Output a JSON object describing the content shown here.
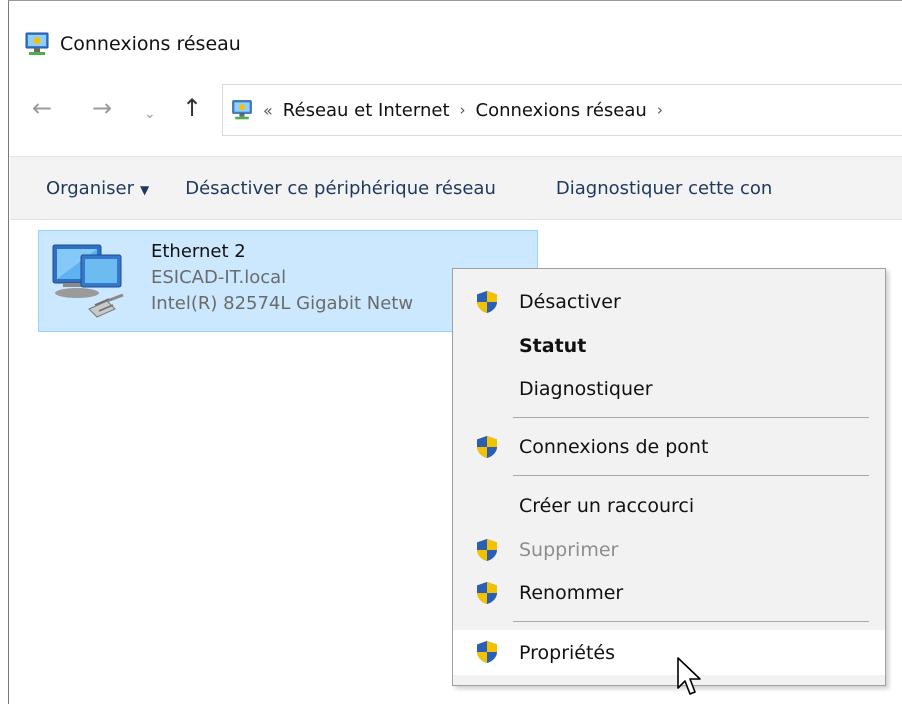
{
  "window": {
    "title": "Connexions réseau"
  },
  "navigation": {
    "back_glyph": "←",
    "forward_glyph": "→",
    "recent_glyph": "⌄",
    "up_glyph": "↑",
    "address_prefix": "«",
    "breadcrumbs": [
      "Réseau et Internet",
      "Connexions réseau"
    ],
    "separator": "›"
  },
  "commandbar": {
    "organise_label": "Organiser",
    "disable_label": "Désactiver ce périphérique réseau",
    "diagnose_label": "Diagnostiquer cette con"
  },
  "adapter": {
    "name": "Ethernet 2",
    "network": "ESICAD-IT.local",
    "device": "Intel(R) 82574L Gigabit Netw"
  },
  "context_menu": {
    "items": [
      {
        "label": "Désactiver",
        "shield": true
      },
      {
        "label": "Statut",
        "bold": true
      },
      {
        "label": "Diagnostiquer"
      },
      {
        "label": "Connexions de pont",
        "shield": true
      },
      {
        "label": "Créer un raccourci"
      },
      {
        "label": "Supprimer",
        "shield": true,
        "disabled": true
      },
      {
        "label": "Renommer",
        "shield": true
      },
      {
        "label": "Propriétés",
        "shield": true,
        "hovered": true
      }
    ]
  },
  "colors": {
    "selection_bg": "#cce8ff",
    "selection_border": "#99d1ff",
    "menu_bg": "#f2f2f2",
    "link_blue": "#1e395b",
    "shield_blue": "#2b5fb3",
    "shield_yellow": "#f2c200"
  }
}
